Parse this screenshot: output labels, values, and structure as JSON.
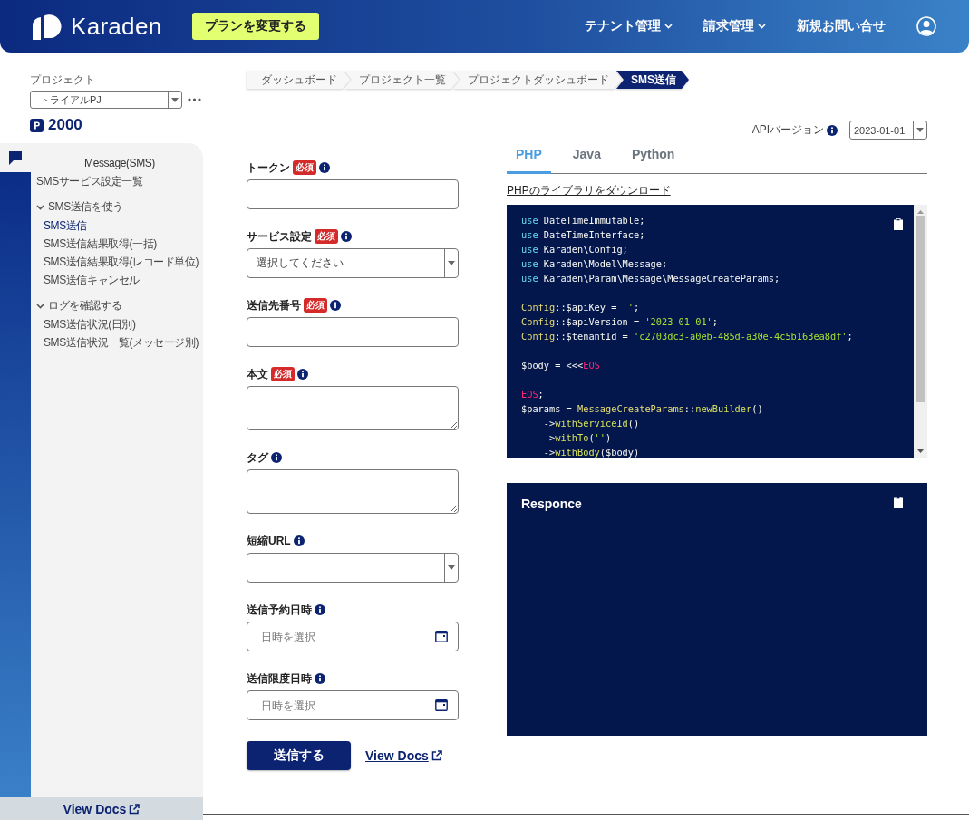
{
  "header": {
    "brand": "Karaden",
    "plan_button": "プランを変更する",
    "nav": [
      {
        "label": "テナント管理",
        "dropdown": true
      },
      {
        "label": "請求管理",
        "dropdown": true
      },
      {
        "label": "新規お問い合せ",
        "dropdown": false
      }
    ]
  },
  "sidebar": {
    "project_label": "プロジェクト",
    "project_value": "トライアルPJ",
    "points": "2000",
    "section_title": "Message(SMS)",
    "items": [
      {
        "label": "SMSサービス設定一覧",
        "selected": false
      },
      {
        "label": "SMS送信を使う",
        "expanded": true,
        "children": [
          {
            "label": "SMS送信",
            "selected": true
          },
          {
            "label": "SMS送信結果取得(一括)",
            "selected": false
          },
          {
            "label": "SMS送信結果取得(レコード単位)",
            "selected": false
          },
          {
            "label": "SMS送信キャンセル",
            "selected": false
          }
        ]
      },
      {
        "label": "ログを確認する",
        "expanded": true,
        "children": [
          {
            "label": "SMS送信状況(日別)",
            "selected": false
          },
          {
            "label": "SMS送信状況一覧(メッセージ別)",
            "selected": false
          }
        ]
      }
    ],
    "footer_link": "View Docs"
  },
  "breadcrumb": [
    {
      "label": "ダッシュボード",
      "selected": false
    },
    {
      "label": "プロジェクト一覧",
      "selected": false
    },
    {
      "label": "プロジェクトダッシュボード",
      "selected": false
    },
    {
      "label": "SMS送信",
      "selected": true
    }
  ],
  "form": {
    "fields": [
      {
        "label": "トークン",
        "badge": "必須",
        "kind": "input"
      },
      {
        "label": "サービス設定",
        "badge": "必須",
        "kind": "select",
        "placeholder": "選択してください"
      },
      {
        "label": "送信先番号",
        "badge": "必須",
        "kind": "input"
      },
      {
        "label": "本文",
        "badge": "必須",
        "kind": "textarea"
      },
      {
        "label": "タグ",
        "kind": "textarea"
      },
      {
        "label": "短縮URL",
        "kind": "select"
      },
      {
        "label": "送信予約日時",
        "kind": "datetime",
        "placeholder": "日時を選択"
      },
      {
        "label": "送信限度日時",
        "kind": "datetime",
        "placeholder": "日時を選択"
      }
    ],
    "submit": "送信する",
    "docs_link": "View Docs"
  },
  "api_version": {
    "label": "APIバージョン",
    "value": "2023-01-01"
  },
  "tabs": [
    {
      "label": "PHP",
      "selected": true
    },
    {
      "label": "Java",
      "selected": false
    },
    {
      "label": "Python",
      "selected": false
    }
  ],
  "download_link": "PHPのライブラリをダウンロード",
  "code": {
    "lines": [
      {
        "kind": "code",
        "tokens": [
          {
            "kind": "keyword",
            "text": "use"
          },
          {
            "kind": "plain",
            "text": " DateTimeImmutable;"
          }
        ]
      },
      {
        "kind": "code",
        "tokens": [
          {
            "kind": "keyword",
            "text": "use"
          },
          {
            "kind": "plain",
            "text": " DateTimeInterface;"
          }
        ]
      },
      {
        "kind": "code",
        "tokens": [
          {
            "kind": "keyword",
            "text": "use"
          },
          {
            "kind": "plain",
            "text": " Karaden\\Config;"
          }
        ]
      },
      {
        "kind": "code",
        "tokens": [
          {
            "kind": "keyword",
            "text": "use"
          },
          {
            "kind": "plain",
            "text": " Karaden\\Model\\Message;"
          }
        ]
      },
      {
        "kind": "code",
        "tokens": [
          {
            "kind": "keyword",
            "text": "use"
          },
          {
            "kind": "plain",
            "text": " Karaden\\Param\\Message\\MessageCreateParams;"
          }
        ]
      },
      {
        "kind": "blank"
      },
      {
        "kind": "code",
        "tokens": [
          {
            "kind": "class",
            "text": "Config"
          },
          {
            "kind": "plain",
            "text": "::$apiKey = "
          },
          {
            "kind": "string",
            "text": "''"
          },
          {
            "kind": "plain",
            "text": ";"
          }
        ]
      },
      {
        "kind": "code",
        "tokens": [
          {
            "kind": "class",
            "text": "Config"
          },
          {
            "kind": "plain",
            "text": "::$apiVersion = "
          },
          {
            "kind": "string",
            "text": "'2023-01-01'"
          },
          {
            "kind": "plain",
            "text": ";"
          }
        ]
      },
      {
        "kind": "code",
        "tokens": [
          {
            "kind": "class",
            "text": "Config"
          },
          {
            "kind": "plain",
            "text": "::$tenantId = "
          },
          {
            "kind": "string",
            "text": "'c2703dc3-a0eb-485d-a30e-4c5b163ea8df'"
          },
          {
            "kind": "plain",
            "text": ";"
          }
        ]
      },
      {
        "kind": "blank"
      },
      {
        "kind": "code",
        "tokens": [
          {
            "kind": "plain",
            "text": "$body = <<<"
          },
          {
            "kind": "heredoc",
            "text": "EOS"
          }
        ]
      },
      {
        "kind": "blank"
      },
      {
        "kind": "code",
        "tokens": [
          {
            "kind": "heredoc",
            "text": "EOS"
          },
          {
            "kind": "plain",
            "text": ";"
          }
        ]
      },
      {
        "kind": "code",
        "tokens": [
          {
            "kind": "plain",
            "text": "$params = "
          },
          {
            "kind": "class",
            "text": "MessageCreateParams"
          },
          {
            "kind": "plain",
            "text": "::"
          },
          {
            "kind": "method",
            "text": "newBuilder"
          },
          {
            "kind": "plain",
            "text": "()"
          }
        ]
      },
      {
        "kind": "code",
        "tokens": [
          {
            "kind": "plain",
            "text": "    ->"
          },
          {
            "kind": "method",
            "text": "withServiceId"
          },
          {
            "kind": "plain",
            "text": "()"
          }
        ]
      },
      {
        "kind": "code",
        "tokens": [
          {
            "kind": "plain",
            "text": "    ->"
          },
          {
            "kind": "method",
            "text": "withTo"
          },
          {
            "kind": "plain",
            "text": "("
          },
          {
            "kind": "string",
            "text": "''"
          },
          {
            "kind": "plain",
            "text": ")"
          }
        ]
      },
      {
        "kind": "code",
        "tokens": [
          {
            "kind": "plain",
            "text": "    ->"
          },
          {
            "kind": "method",
            "text": "withBody"
          },
          {
            "kind": "plain",
            "text": "($body)"
          }
        ]
      }
    ]
  },
  "response": {
    "title": "Responce"
  }
}
